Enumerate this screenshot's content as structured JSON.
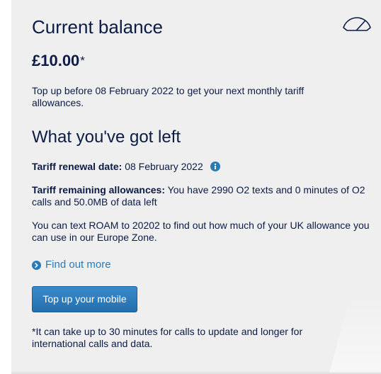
{
  "balance_panel": {
    "title": "Current balance",
    "balance_amount": "£10.00",
    "balance_asterisk": "*",
    "topup_info": "Top up before 08 February 2022 to get your next monthly tariff allowances.",
    "icon": "speedometer-icon"
  },
  "remaining": {
    "title": "What you've got left",
    "renewal_label": "Tariff renewal date:",
    "renewal_date": "08 February 2022",
    "allowances_label": "Tariff remaining allowances:",
    "allowances_text": "You have 2990 O2 texts and 0 minutes of O2 calls and 50.0MB of data left",
    "roam_text": "You can text ROAM to 20202 to find out how much of your UK allowance you can use in our Europe Zone.",
    "find_out_more": "Find out more",
    "topup_button": "Top up your mobile",
    "footnote": "*It can take up to 30 minutes for calls to update and longer for international calls and data."
  },
  "colors": {
    "text_navy": "#0b1b45",
    "link_blue": "#2a7ab8",
    "button_blue": "#2f7dbf",
    "panel_bg": "#efefef"
  }
}
